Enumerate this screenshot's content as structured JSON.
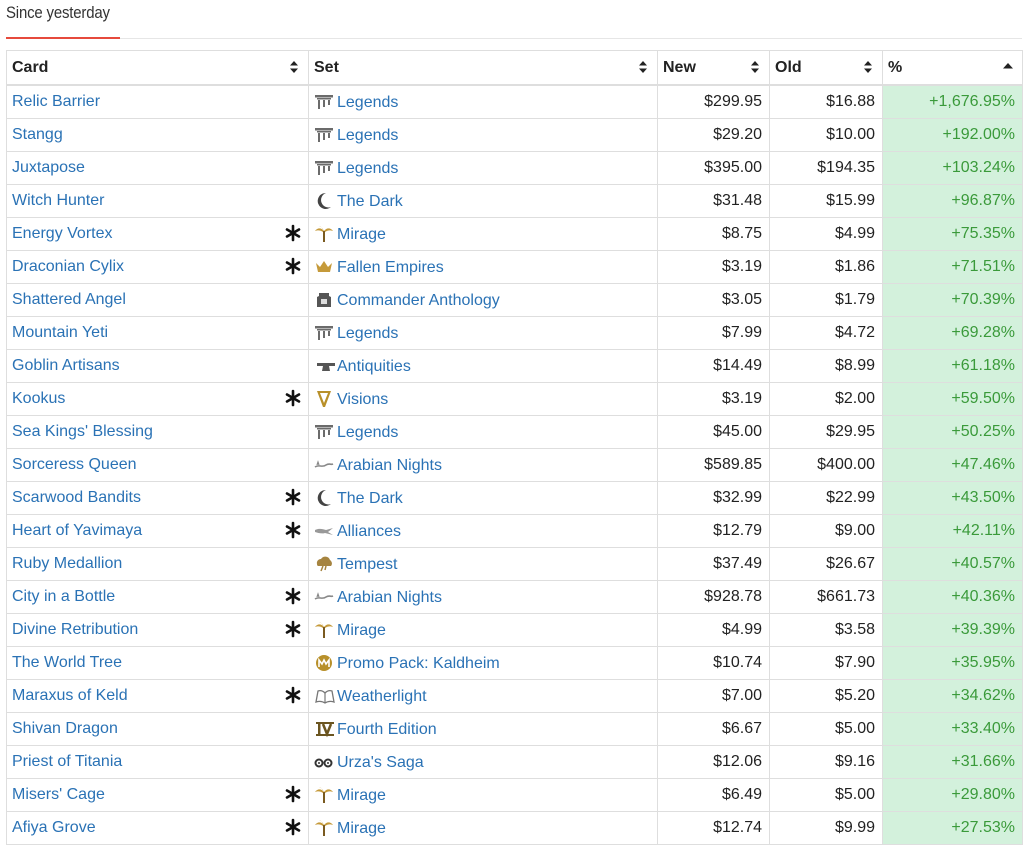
{
  "heading": "Since yesterday",
  "columns": {
    "card": "Card",
    "set": "Set",
    "new": "New",
    "old": "Old",
    "pct": "%"
  },
  "colors": {
    "link": "#2a72b5",
    "positive": "#3a9a3a",
    "positive_bg": "#d3f1dc",
    "accent": "#e64a3c"
  },
  "rows": [
    {
      "card": "Relic Barrier",
      "foil": false,
      "set": "Legends",
      "set_icon": "legends-icon",
      "new": "$299.95",
      "old": "$16.88",
      "pct": "+1,676.95%"
    },
    {
      "card": "Stangg",
      "foil": false,
      "set": "Legends",
      "set_icon": "legends-icon",
      "new": "$29.20",
      "old": "$10.00",
      "pct": "+192.00%"
    },
    {
      "card": "Juxtapose",
      "foil": false,
      "set": "Legends",
      "set_icon": "legends-icon",
      "new": "$395.00",
      "old": "$194.35",
      "pct": "+103.24%"
    },
    {
      "card": "Witch Hunter",
      "foil": false,
      "set": "The Dark",
      "set_icon": "the-dark-icon",
      "new": "$31.48",
      "old": "$15.99",
      "pct": "+96.87%"
    },
    {
      "card": "Energy Vortex",
      "foil": true,
      "set": "Mirage",
      "set_icon": "mirage-icon",
      "new": "$8.75",
      "old": "$4.99",
      "pct": "+75.35%"
    },
    {
      "card": "Draconian Cylix",
      "foil": true,
      "set": "Fallen Empires",
      "set_icon": "fallen-empires-icon",
      "new": "$3.19",
      "old": "$1.86",
      "pct": "+71.51%"
    },
    {
      "card": "Shattered Angel",
      "foil": false,
      "set": "Commander Anthology",
      "set_icon": "commander-anthology-icon",
      "new": "$3.05",
      "old": "$1.79",
      "pct": "+70.39%"
    },
    {
      "card": "Mountain Yeti",
      "foil": false,
      "set": "Legends",
      "set_icon": "legends-icon",
      "new": "$7.99",
      "old": "$4.72",
      "pct": "+69.28%"
    },
    {
      "card": "Goblin Artisans",
      "foil": false,
      "set": "Antiquities",
      "set_icon": "antiquities-icon",
      "new": "$14.49",
      "old": "$8.99",
      "pct": "+61.18%"
    },
    {
      "card": "Kookus",
      "foil": true,
      "set": "Visions",
      "set_icon": "visions-icon",
      "new": "$3.19",
      "old": "$2.00",
      "pct": "+59.50%"
    },
    {
      "card": "Sea Kings' Blessing",
      "foil": false,
      "set": "Legends",
      "set_icon": "legends-icon",
      "new": "$45.00",
      "old": "$29.95",
      "pct": "+50.25%"
    },
    {
      "card": "Sorceress Queen",
      "foil": false,
      "set": "Arabian Nights",
      "set_icon": "arabian-nights-icon",
      "new": "$589.85",
      "old": "$400.00",
      "pct": "+47.46%"
    },
    {
      "card": "Scarwood Bandits",
      "foil": true,
      "set": "The Dark",
      "set_icon": "the-dark-icon",
      "new": "$32.99",
      "old": "$22.99",
      "pct": "+43.50%"
    },
    {
      "card": "Heart of Yavimaya",
      "foil": true,
      "set": "Alliances",
      "set_icon": "alliances-icon",
      "new": "$12.79",
      "old": "$9.00",
      "pct": "+42.11%"
    },
    {
      "card": "Ruby Medallion",
      "foil": false,
      "set": "Tempest",
      "set_icon": "tempest-icon",
      "new": "$37.49",
      "old": "$26.67",
      "pct": "+40.57%"
    },
    {
      "card": "City in a Bottle",
      "foil": true,
      "set": "Arabian Nights",
      "set_icon": "arabian-nights-icon",
      "new": "$928.78",
      "old": "$661.73",
      "pct": "+40.36%"
    },
    {
      "card": "Divine Retribution",
      "foil": true,
      "set": "Mirage",
      "set_icon": "mirage-icon",
      "new": "$4.99",
      "old": "$3.58",
      "pct": "+39.39%"
    },
    {
      "card": "The World Tree",
      "foil": false,
      "set": "Promo Pack: Kaldheim",
      "set_icon": "promo-pack-icon",
      "new": "$10.74",
      "old": "$7.90",
      "pct": "+35.95%"
    },
    {
      "card": "Maraxus of Keld",
      "foil": true,
      "set": "Weatherlight",
      "set_icon": "weatherlight-icon",
      "new": "$7.00",
      "old": "$5.20",
      "pct": "+34.62%"
    },
    {
      "card": "Shivan Dragon",
      "foil": false,
      "set": "Fourth Edition",
      "set_icon": "fourth-edition-icon",
      "new": "$6.67",
      "old": "$5.00",
      "pct": "+33.40%"
    },
    {
      "card": "Priest of Titania",
      "foil": false,
      "set": "Urza's Saga",
      "set_icon": "urzas-saga-icon",
      "new": "$12.06",
      "old": "$9.16",
      "pct": "+31.66%"
    },
    {
      "card": "Misers' Cage",
      "foil": true,
      "set": "Mirage",
      "set_icon": "mirage-icon",
      "new": "$6.49",
      "old": "$5.00",
      "pct": "+29.80%"
    },
    {
      "card": "Afiya Grove",
      "foil": true,
      "set": "Mirage",
      "set_icon": "mirage-icon",
      "new": "$12.74",
      "old": "$9.99",
      "pct": "+27.53%"
    }
  ]
}
